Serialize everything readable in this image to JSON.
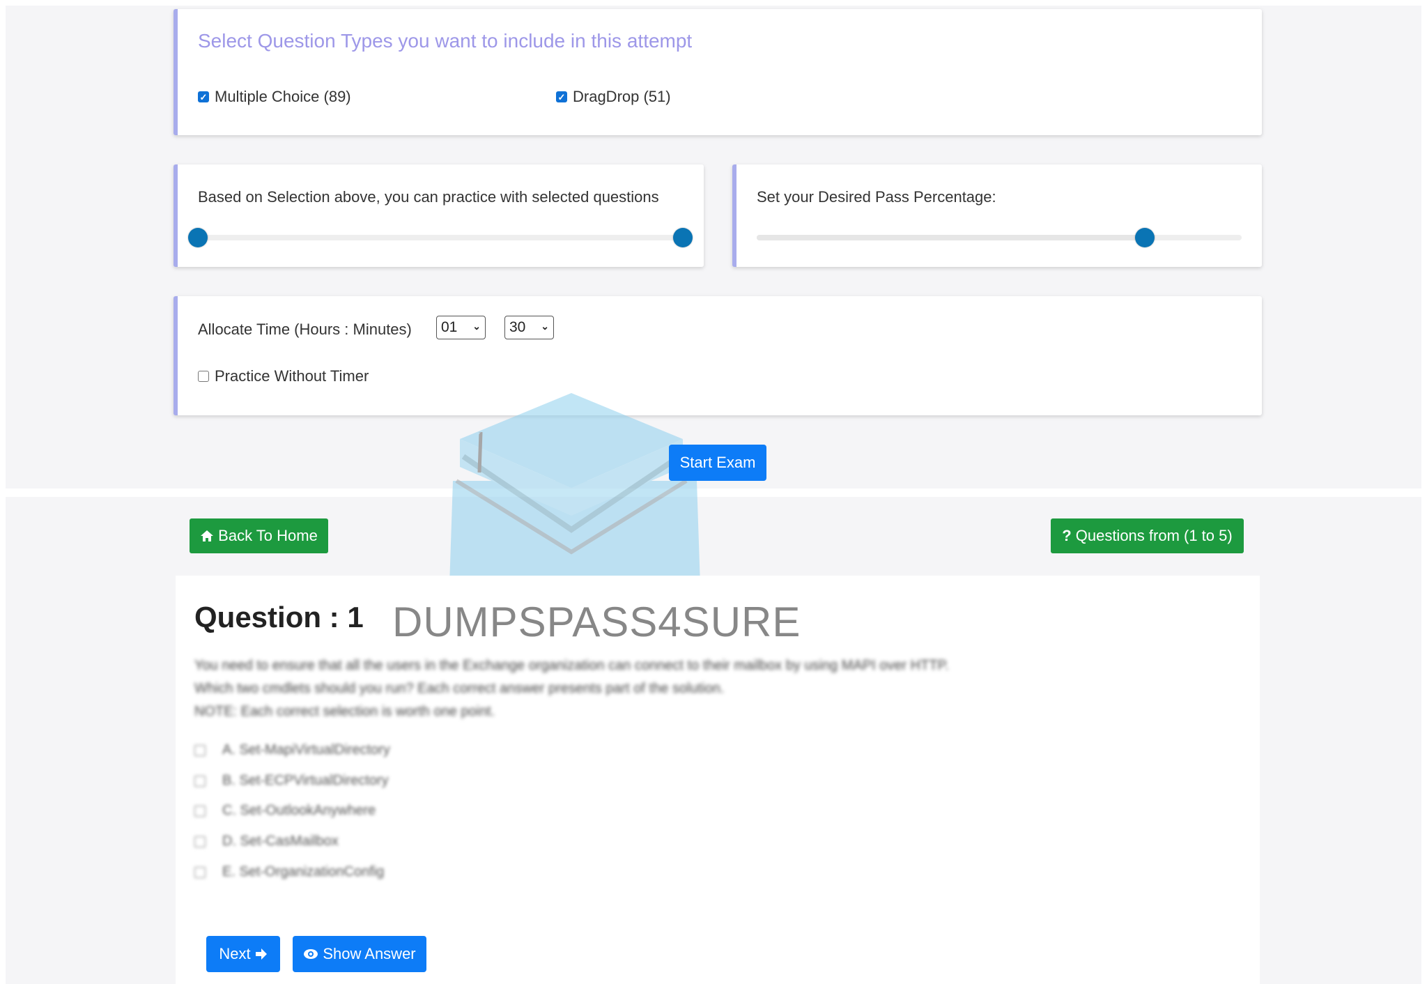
{
  "settings": {
    "question_types_title": "Select Question Types you want to include in this attempt",
    "question_types": [
      {
        "label": "Multiple Choice (89)",
        "checked": true
      },
      {
        "label": "DragDrop (51)",
        "checked": true
      }
    ],
    "practice_label": "Based on Selection above, you can practice with selected questions",
    "question_range": {
      "min_fraction": 0.0,
      "max_fraction": 1.0
    },
    "pass_label": "Set your Desired Pass Percentage:",
    "pass_fraction": 0.8,
    "time_label": "Allocate Time (Hours : Minutes)",
    "hours_value": "01",
    "minutes_value": "30",
    "no_timer_label": "Practice Without Timer",
    "no_timer_checked": false,
    "start_label": "Start Exam"
  },
  "nav": {
    "back_label": "Back To Home",
    "questions_range_label": "Questions from (1 to 5)"
  },
  "question": {
    "title": "Question : 1",
    "brand": "DUMPSPASS4SURE",
    "lines": [
      "You need to ensure that all the users in the Exchange organization can connect to their mailbox by using MAPI over HTTP.",
      "Which two cmdlets should you run? Each correct answer presents part of the solution.",
      "NOTE: Each correct selection is worth one point."
    ],
    "options": [
      "A. Set-MapiVirtualDirectory",
      "B. Set-ECPVirtualDirectory",
      "C. Set-OutlookAnywhere",
      "D. Set-CasMailbox",
      "E. Set-OrganizationConfig"
    ],
    "next_label": "Next",
    "show_answer_label": "Show Answer"
  },
  "colors": {
    "accent_border": "#a8acec",
    "title_purple": "#9d97e8",
    "primary_blue": "#0d7cf7",
    "success_green": "#1d9a3f",
    "slider_handle": "#0a74b4"
  },
  "icons": {
    "home": "home-icon",
    "question": "question-icon",
    "next_arrow": "arrow-right-icon",
    "eye": "eye-icon",
    "watermark": "graduation-cap-logo"
  }
}
